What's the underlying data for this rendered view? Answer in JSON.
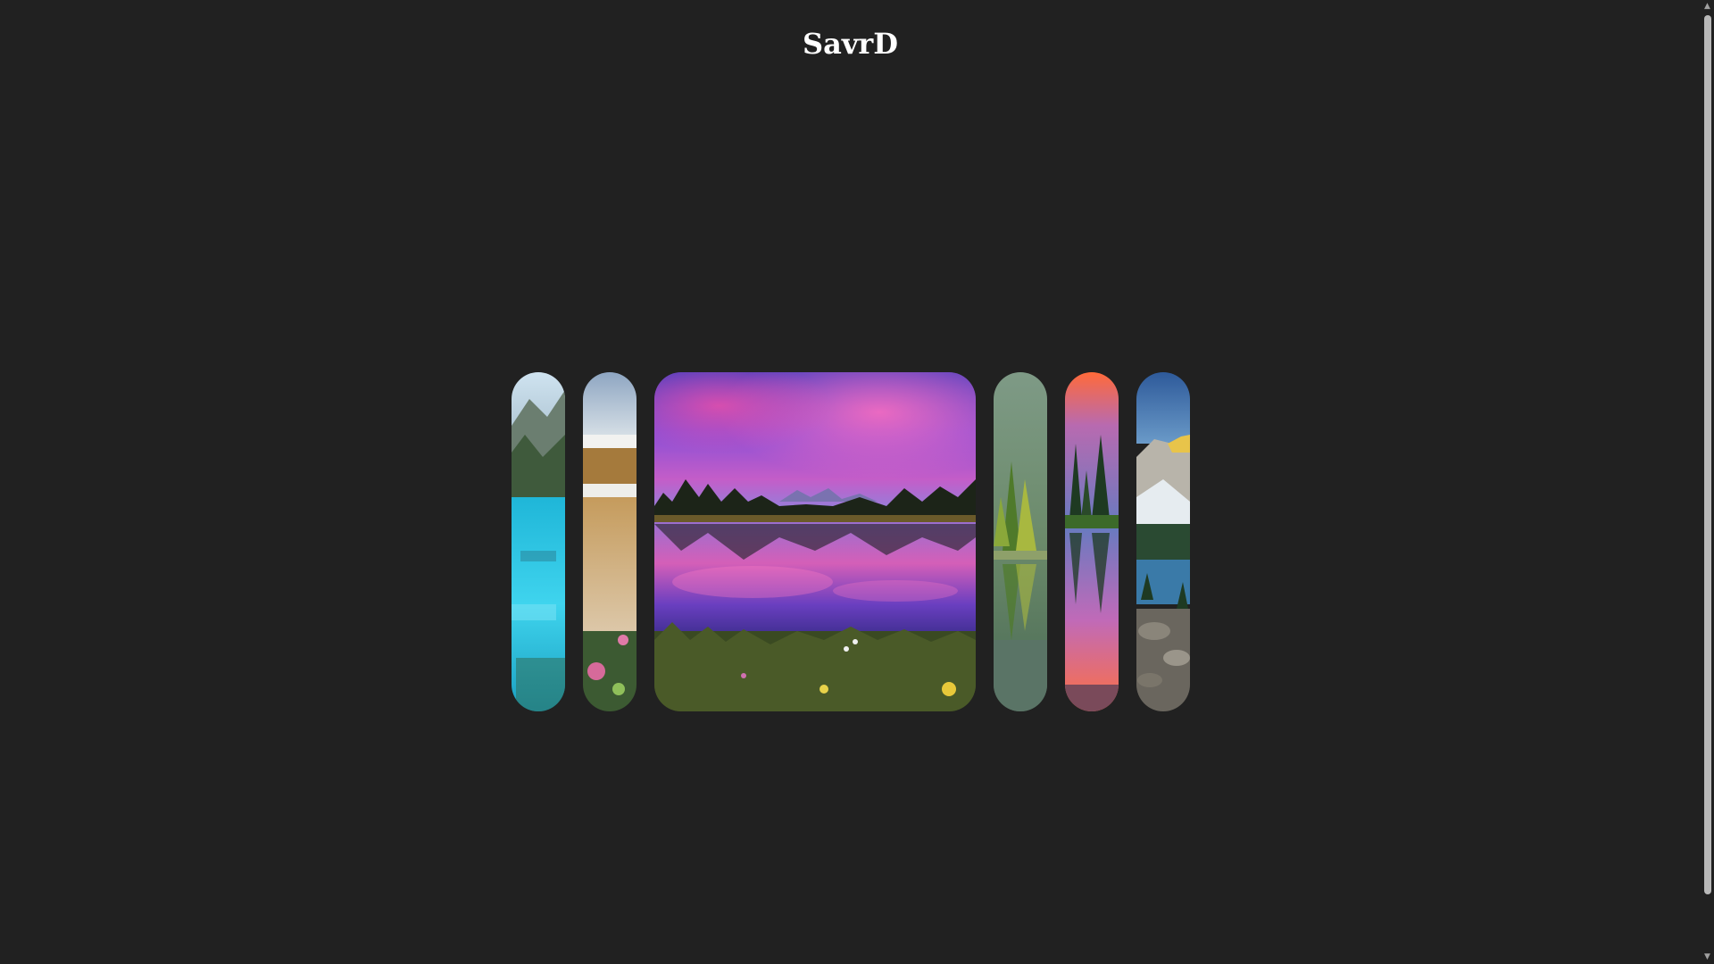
{
  "header": {
    "title": "SavrD"
  },
  "gallery": {
    "active_index": 2,
    "panels": [
      {
        "name": "turquoise-lake",
        "active": false
      },
      {
        "name": "misty-shore-flowers",
        "active": false
      },
      {
        "name": "sunset-lake-reflection",
        "active": true
      },
      {
        "name": "green-forest-reflection",
        "active": false
      },
      {
        "name": "orange-sunset-pines",
        "active": false
      },
      {
        "name": "mountain-lake-rocks",
        "active": false
      }
    ]
  },
  "scrollbar": {
    "up_icon": "triangle-up-icon",
    "down_icon": "triangle-down-icon"
  }
}
